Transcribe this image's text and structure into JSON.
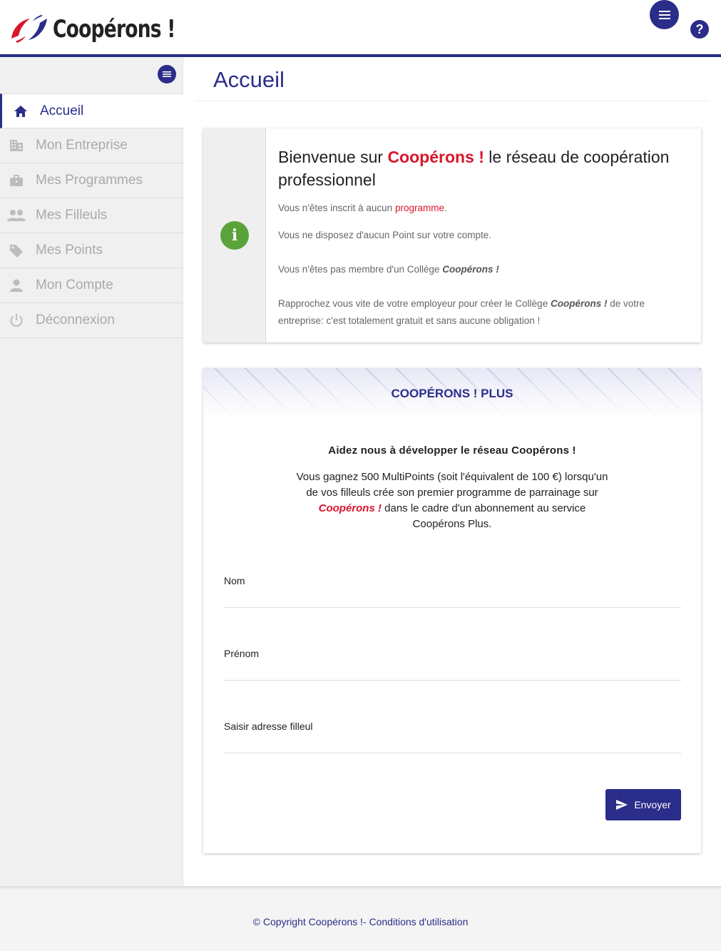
{
  "header": {
    "logo_text": "Coopérons !",
    "menu_icon": "hamburger-icon",
    "help_label": "?"
  },
  "sidebar": {
    "toggle_icon": "menu-icon",
    "items": [
      {
        "label": "Accueil",
        "icon": "home-icon",
        "active": true
      },
      {
        "label": "Mon Entreprise",
        "icon": "building-icon",
        "active": false
      },
      {
        "label": "Mes Programmes",
        "icon": "briefcase-icon",
        "active": false
      },
      {
        "label": "Mes Filleuls",
        "icon": "people-icon",
        "active": false
      },
      {
        "label": "Mes Points",
        "icon": "tag-icon",
        "active": false
      },
      {
        "label": "Mon Compte",
        "icon": "person-icon",
        "active": false
      },
      {
        "label": "Déconnexion",
        "icon": "power-icon",
        "active": false
      }
    ]
  },
  "main": {
    "title": "Accueil",
    "info": {
      "title_before": "Bienvenue sur ",
      "title_brand": "Coopérons !",
      "title_after": " le réseau de coopération professionnel",
      "line1_text": "Vous n'êtes inscrit à aucun ",
      "line1_link": "programme",
      "line1_end": ".",
      "line2": "Vous ne disposez d'aucun Point sur votre compte.",
      "line3_text": "Vous n'êtes pas membre d'un Collège ",
      "line3_brand": "Coopérons !",
      "line4_text": "Rapprochez vous vite de votre employeur pour créer le Collège ",
      "line4_brand": "Coopérons !",
      "line4_end": " de votre entreprise: c'est totalement gratuit et sans aucune obligation !"
    },
    "plus": {
      "title": "COOPÉRONS ! PLUS",
      "subtitle": "Aidez nous à développer le réseau Coopérons !",
      "text_before": "Vous gagnez 500 MultiPoints (soit l'équivalent de 100 €) lorsqu'un de vos filleuls crée son premier programme de parrainage sur ",
      "text_brand": "Coopérons !",
      "text_after": " dans le cadre d'un abonnement au service Coopérons Plus.",
      "fields": [
        {
          "label": "Nom",
          "value": ""
        },
        {
          "label": "Prénom",
          "value": ""
        },
        {
          "label": "Saisir adresse filleul",
          "value": ""
        }
      ],
      "send_label": "Envoyer"
    }
  },
  "footer": {
    "copyright": "© Copyright Coopérons !",
    "separator": "- ",
    "terms": "Conditions d'utilisation"
  },
  "colors": {
    "primary": "#2b2d8a",
    "brand_red": "#d9162c",
    "info_green": "#5aa33b"
  }
}
